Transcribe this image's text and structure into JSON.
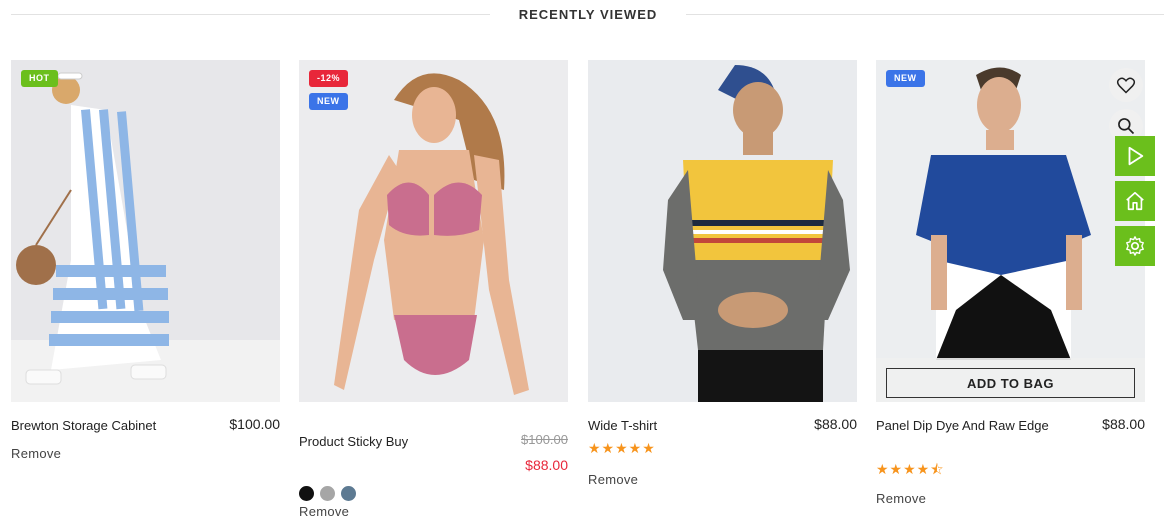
{
  "section": {
    "title": "RECENTLY VIEWED"
  },
  "products": [
    {
      "name": "Brewton Storage Cabinet",
      "price": "$100.00",
      "badges": [
        "HOT"
      ],
      "remove": "Remove"
    },
    {
      "name": "Product Sticky Buy",
      "old_price": "$100.00",
      "new_price": "$88.00",
      "badges": [
        "-12%",
        "NEW"
      ],
      "swatches": [
        "#111111",
        "#a6a6a6",
        "#5d7a92"
      ],
      "remove": "Remove"
    },
    {
      "name": "Wide T-shirt",
      "price": "$88.00",
      "rating": 5,
      "stars": "★★★★★",
      "remove": "Remove"
    },
    {
      "name": "Panel Dip Dye And Raw Edge",
      "price": "$88.00",
      "badges": [
        "NEW"
      ],
      "rating": 4.5,
      "stars": "★★★★⯪",
      "add_to_bag": "ADD TO BAG",
      "remove": "Remove"
    }
  ],
  "icons": {
    "wishlist": "heart-icon",
    "quick_view": "search-icon"
  },
  "side_tools": [
    "play-icon",
    "home-icon",
    "gear-icon"
  ],
  "colors": {
    "accent_green": "#6bbf1c",
    "sale_red": "#e8273a",
    "new_blue": "#3b74e8",
    "star": "#f7941d"
  }
}
